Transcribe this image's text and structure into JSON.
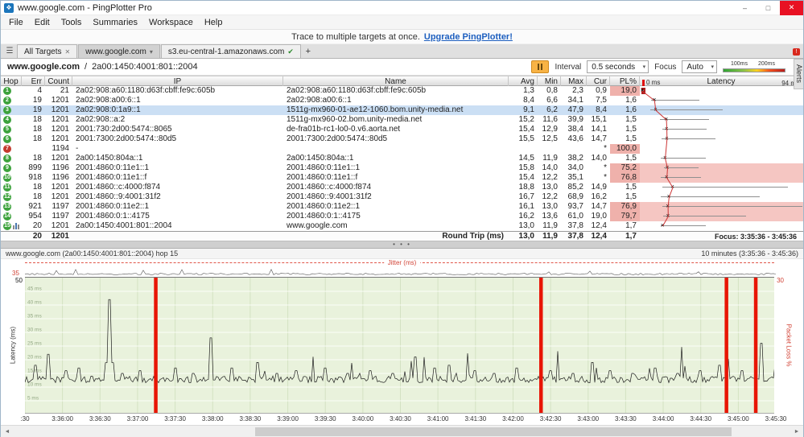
{
  "window": {
    "title": "www.google.com - PingPlotter Pro"
  },
  "icons": {
    "app": "❖",
    "minimize": "–",
    "maximize": "□",
    "close": "✕",
    "menu_burger": "☰",
    "tab_close": "✕",
    "check": "✔",
    "chevron_down": "▾",
    "add_tab": "+",
    "alert_badge": "!",
    "combo_arrow": "▾",
    "splitter_dots": "• • •",
    "scroll_left": "◄",
    "scroll_right": "►"
  },
  "menu": {
    "items": [
      "File",
      "Edit",
      "Tools",
      "Summaries",
      "Workspace",
      "Help"
    ]
  },
  "promo": {
    "text": "Trace to multiple targets at once.",
    "link": "Upgrade PingPlotter!"
  },
  "tabs": {
    "all_targets": "All Targets",
    "target1": "www.google.com",
    "target2": "s3.eu-central-1.amazonaws.com"
  },
  "alerts_tab": {
    "label": "Alerts"
  },
  "target_bar": {
    "host": "www.google.com",
    "separator": "/",
    "ip": "2a00:1450:4001:801::2004",
    "interval_label": "Interval",
    "interval_value": "0.5 seconds",
    "focus_label": "Focus",
    "focus_value": "Auto",
    "legend_100": "100ms",
    "legend_200": "200ms"
  },
  "table": {
    "headers": {
      "hop": "Hop",
      "err": "Err",
      "count": "Count",
      "ip": "IP",
      "name": "Name",
      "avg": "Avg",
      "min": "Min",
      "max": "Max",
      "cur": "Cur",
      "pl": "PL%",
      "latency": "Latency",
      "scale_min": "0 ms",
      "scale_max": "94 ms"
    },
    "latency_scale_max_ms": 94,
    "rows": [
      {
        "hop": "1",
        "err": "4",
        "count": "21",
        "ip": "2a02:908:a60:1180:d63f:cbff:fe9c:605b",
        "name": "2a02:908:a60:1180:d63f:cbff:fe9c:605b",
        "avg": "1,3",
        "min": "0,8",
        "max": "2,3",
        "cur": "0,9",
        "pl": "19,0",
        "pl_high": true,
        "latency_style": "redbar"
      },
      {
        "hop": "2",
        "err": "19",
        "count": "1201",
        "ip": "2a02:908:a00:6::1",
        "name": "2a02:908:a00:6::1",
        "avg": "8,4",
        "min": "6,6",
        "max": "34,1",
        "cur": "7,5",
        "pl": "1,6"
      },
      {
        "hop": "3",
        "err": "19",
        "count": "1201",
        "ip": "2a02:908:0:1a9::1",
        "name": "1511g-mx960-01-ae12-1060.bom.unity-media.net",
        "avg": "9,1",
        "min": "6,2",
        "max": "47,9",
        "cur": "8,4",
        "pl": "1,6",
        "selected": true
      },
      {
        "hop": "4",
        "err": "18",
        "count": "1201",
        "ip": "2a02:908::a:2",
        "name": "1511g-mx960-02.bom.unity-media.net",
        "avg": "15,2",
        "min": "11,6",
        "max": "39,9",
        "cur": "15,1",
        "pl": "1,5"
      },
      {
        "hop": "5",
        "err": "18",
        "count": "1201",
        "ip": "2001:730:2d00:5474::8065",
        "name": "de-fra01b-rc1-lo0-0.v6.aorta.net",
        "avg": "15,4",
        "min": "12,9",
        "max": "38,4",
        "cur": "14,1",
        "pl": "1,5"
      },
      {
        "hop": "6",
        "err": "18",
        "count": "1201",
        "ip": "2001:7300:2d00:5474::80d5",
        "name": "2001:7300:2d00:5474::80d5",
        "avg": "15,5",
        "min": "12,5",
        "max": "43,6",
        "cur": "14,7",
        "pl": "1,5"
      },
      {
        "hop": "7",
        "err": "",
        "count": "1194",
        "ip": "-",
        "name": "",
        "avg": "",
        "min": "",
        "max": "",
        "cur": "*",
        "pl": "100,0",
        "pl_high": true,
        "timeout": true
      },
      {
        "hop": "8",
        "err": "18",
        "count": "1201",
        "ip": "2a00:1450:804a::1",
        "name": "2a00:1450:804a::1",
        "avg": "14,5",
        "min": "11,9",
        "max": "38,2",
        "cur": "14,0",
        "pl": "1,5"
      },
      {
        "hop": "9",
        "err": "899",
        "count": "1196",
        "ip": "2001:4860:0:11e1::1",
        "name": "2001:4860:0:11e1::1",
        "avg": "15,8",
        "min": "14,0",
        "max": "34,0",
        "cur": "*",
        "pl": "75,2",
        "pl_high": true,
        "latency_style": "pink"
      },
      {
        "hop": "10",
        "err": "918",
        "count": "1196",
        "ip": "2001:4860:0:11e1::f",
        "name": "2001:4860:0:11e1::f",
        "avg": "15,4",
        "min": "12,2",
        "max": "35,1",
        "cur": "*",
        "pl": "76,8",
        "pl_high": true,
        "latency_style": "pink"
      },
      {
        "hop": "11",
        "err": "18",
        "count": "1201",
        "ip": "2001:4860::c:4000:f874",
        "name": "2001:4860::c:4000:f874",
        "avg": "18,8",
        "min": "13,0",
        "max": "85,2",
        "cur": "14,9",
        "pl": "1,5"
      },
      {
        "hop": "12",
        "err": "18",
        "count": "1201",
        "ip": "2001:4860::9:4001:31f2",
        "name": "2001:4860::9:4001:31f2",
        "avg": "16,7",
        "min": "12,2",
        "max": "68,9",
        "cur": "16,2",
        "pl": "1,5"
      },
      {
        "hop": "13",
        "err": "921",
        "count": "1197",
        "ip": "2001:4860:0:11e2::1",
        "name": "2001:4860:0:11e2::1",
        "avg": "16,1",
        "min": "13,0",
        "max": "93,7",
        "cur": "14,7",
        "pl": "76,9",
        "pl_high": true,
        "latency_style": "pink"
      },
      {
        "hop": "14",
        "err": "954",
        "count": "1197",
        "ip": "2001:4860:0:1::4175",
        "name": "2001:4860:0:1::4175",
        "avg": "16,2",
        "min": "13,6",
        "max": "61,0",
        "cur": "19,0",
        "pl": "79,7",
        "pl_high": true,
        "latency_style": "pink"
      },
      {
        "hop": "15",
        "err": "20",
        "count": "1201",
        "ip": "2a00:1450:4001:801::2004",
        "name": "www.google.com",
        "avg": "13,0",
        "min": "11,9",
        "max": "37,8",
        "cur": "12,4",
        "pl": "1,7",
        "graph": true
      }
    ],
    "footer": {
      "err": "20",
      "count": "1201",
      "label": "Round Trip (ms)",
      "avg": "13,0",
      "min": "11,9",
      "max": "37,8",
      "cur": "12,4",
      "pl": "1,7",
      "focus": "Focus: 3:35:36 - 3:45:36"
    }
  },
  "timeline": {
    "title": "www.google.com (2a00:1450:4001:801::2004) hop 15",
    "range": "10 minutes (3:35:36 - 3:45:36)",
    "jitter_label": "Jitter (ms)",
    "jitter_max": "35",
    "latency_axis_label": "Latency (ms)",
    "latency_axis_max": "50",
    "loss_axis_label": "Packet Loss %",
    "loss_axis_max": "30",
    "x_ticks": [
      ":30",
      "3:36:00",
      "3:36:30",
      "3:37:00",
      "3:37:30",
      "3:38:00",
      "3:38:30",
      "3:39:00",
      "3:39:30",
      "3:40:00",
      "3:40:30",
      "3:41:00",
      "3:41:30",
      "3:42:00",
      "3:42:30",
      "3:43:00",
      "3:43:30",
      "3:44:00",
      "3:44:30",
      "3:45:00",
      "3:45:30"
    ]
  },
  "chart_data": {
    "type": "line",
    "title": "www.google.com (2a00:1450:4001:801::2004) hop 15",
    "x_range_label": "10 minutes (3:35:36 - 3:45:36)",
    "y_left": {
      "label": "Latency (ms)",
      "min": 0,
      "max": 50
    },
    "y_right": {
      "label": "Packet Loss %",
      "min": 0,
      "max": 30
    },
    "gridline_step_ms": 5,
    "baseline_latency_ms": 12.5,
    "spikes": [
      {
        "t": 0.015,
        "ms": 18
      },
      {
        "t": 0.032,
        "ms": 22
      },
      {
        "t": 0.054,
        "ms": 16
      },
      {
        "t": 0.072,
        "ms": 17
      },
      {
        "t": 0.112,
        "ms": 42
      },
      {
        "t": 0.13,
        "ms": 15
      },
      {
        "t": 0.153,
        "ms": 16
      },
      {
        "t": 0.2,
        "ms": 17
      },
      {
        "t": 0.225,
        "ms": 15
      },
      {
        "t": 0.248,
        "ms": 28
      },
      {
        "t": 0.275,
        "ms": 17
      },
      {
        "t": 0.31,
        "ms": 19
      },
      {
        "t": 0.335,
        "ms": 15
      },
      {
        "t": 0.362,
        "ms": 16
      },
      {
        "t": 0.4,
        "ms": 17
      },
      {
        "t": 0.43,
        "ms": 15
      },
      {
        "t": 0.46,
        "ms": 16
      },
      {
        "t": 0.49,
        "ms": 15
      },
      {
        "t": 0.52,
        "ms": 21
      },
      {
        "t": 0.545,
        "ms": 17
      },
      {
        "t": 0.565,
        "ms": 18
      },
      {
        "t": 0.6,
        "ms": 16
      },
      {
        "t": 0.625,
        "ms": 15
      },
      {
        "t": 0.655,
        "ms": 17
      },
      {
        "t": 0.7,
        "ms": 16
      },
      {
        "t": 0.73,
        "ms": 15
      },
      {
        "t": 0.755,
        "ms": 19
      },
      {
        "t": 0.78,
        "ms": 16
      },
      {
        "t": 0.81,
        "ms": 15
      },
      {
        "t": 0.84,
        "ms": 17
      },
      {
        "t": 0.87,
        "ms": 15
      },
      {
        "t": 0.9,
        "ms": 16
      },
      {
        "t": 0.925,
        "ms": 18
      },
      {
        "t": 0.955,
        "ms": 16
      },
      {
        "t": 0.98,
        "ms": 26
      }
    ],
    "loss_bars_t": [
      0.174,
      0.687,
      0.934,
      0.973
    ],
    "hop_latency_chart": {
      "note": "per-hop min/avg/max shown in table Latency column",
      "scale_max_ms": 94
    }
  }
}
